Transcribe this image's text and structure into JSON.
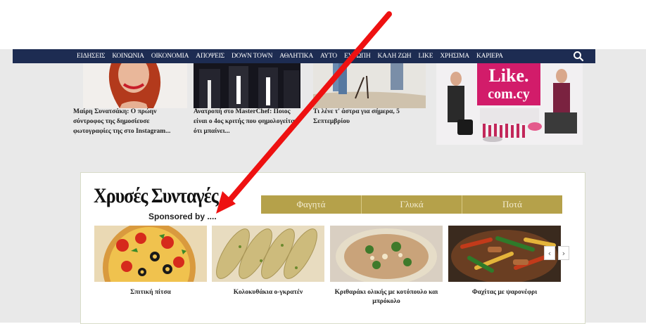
{
  "nav": {
    "items": [
      "ΕΙΔΗΣΕΙΣ",
      "ΚΟΙΝΩΝΙΑ",
      "ΟΙΚΟΝΟΜΙΑ",
      "ΑΠΟΨΕΙΣ",
      "DOWN TOWN",
      "ΑΘΛΗΤΙΚΑ",
      "ΑΥΤΟ",
      "ΕΥΡΩΠΗ",
      "ΚΑΛΗ ΖΩΗ",
      "LIKE",
      "ΧΡΗΣΙΜΑ",
      "ΚΑΡΙΕΡΑ"
    ],
    "search_icon": "search-icon"
  },
  "articles": [
    {
      "caption": "Μαίρη Συνατσάκη: Ο πρώην σύντροφος της δημοσίευσε φωτογραφίες της στο Instagram..."
    },
    {
      "caption": "Ανατροπή στο MasterChef: Ποιος είναι ο 4ος κριτής που φημολογείται ότι μπαίνει..."
    },
    {
      "caption": "Τι λένε τ' άστρα για σήμερα, 5 Σεπτεμβρίου"
    }
  ],
  "ad": {
    "brand": "Like.",
    "domain": "com.cy"
  },
  "recipes": {
    "title": "Χρυσές Συνταγές",
    "sponsored": "Sponsored by ....",
    "tabs": [
      "Φαγητά",
      "Γλυκά",
      "Ποτά"
    ],
    "items": [
      {
        "title": "Σπιτική πίτσα"
      },
      {
        "title": "Κολοκυθάκια ο-γκρατέν"
      },
      {
        "title": "Κριθαράκι ολικής με κοτόπουλο και μπρόκολο"
      },
      {
        "title": "Φαχίτας με ψαρονέφρι"
      }
    ],
    "prev_label": "‹",
    "next_label": "›"
  },
  "colors": {
    "nav_bg": "#1d2c52",
    "tab_bg": "#b5a14a",
    "annotation_arrow": "#ee1111"
  }
}
